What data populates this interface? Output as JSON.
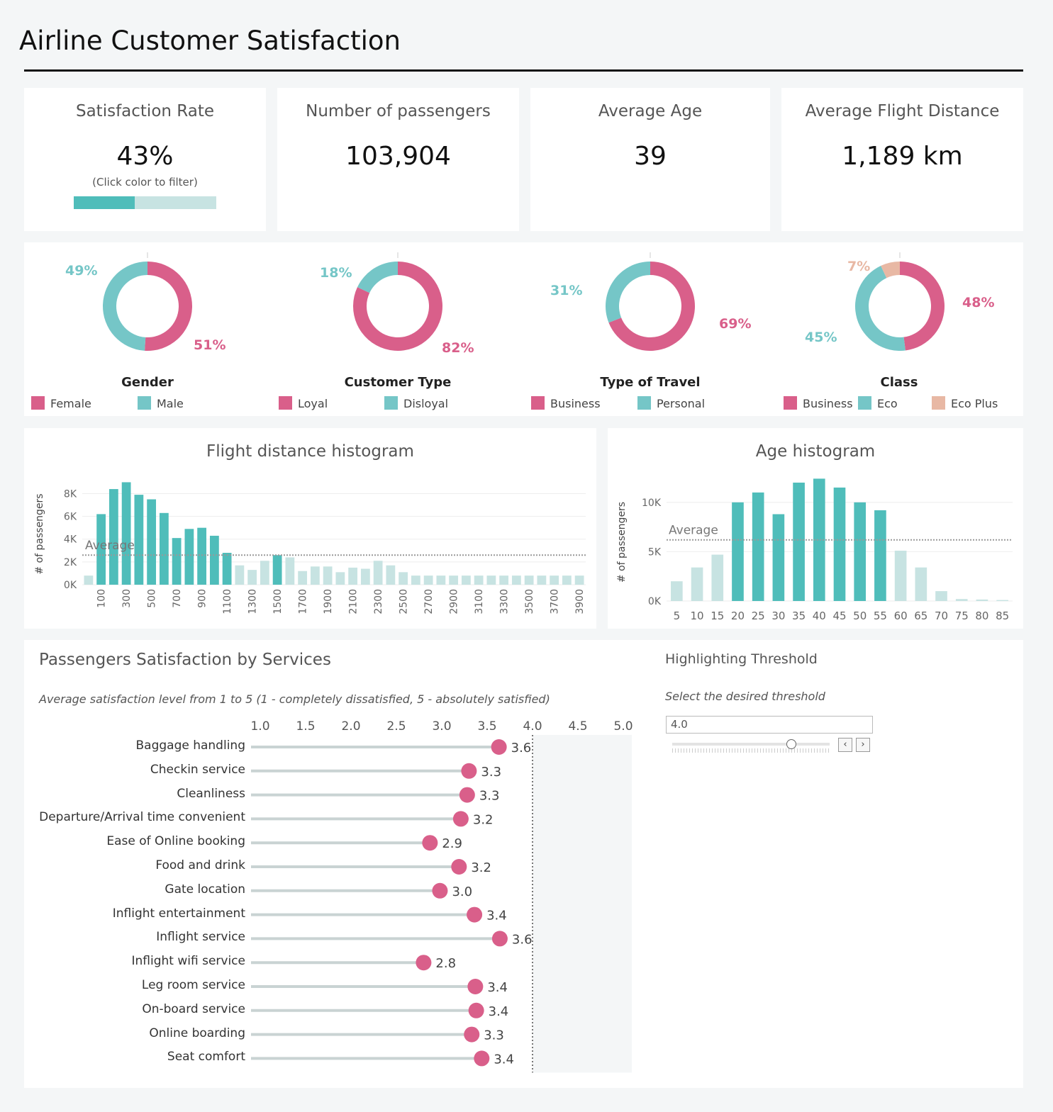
{
  "title": "Airline Customer Satisfaction",
  "colors": {
    "teal": "#4fbdba",
    "teal_light": "#c7e3e2",
    "pink": "#d95f8a",
    "peach": "#e8b8a4"
  },
  "kpis": [
    {
      "label": "Satisfaction Rate",
      "value": "43%",
      "hint": "(Click color to filter)",
      "fraction": 0.43
    },
    {
      "label": "Number of passengers",
      "value": "103,904"
    },
    {
      "label": "Average Age",
      "value": "39"
    },
    {
      "label": "Average Flight Distance",
      "value": "1,189 km"
    }
  ],
  "donuts": [
    {
      "title": "Gender",
      "slices": [
        {
          "name": "Female",
          "pct": 51,
          "label": "51%",
          "color": "#d95f8a"
        },
        {
          "name": "Male",
          "pct": 49,
          "label": "49%",
          "color": "#75c6c7"
        }
      ]
    },
    {
      "title": "Customer Type",
      "slices": [
        {
          "name": "Loyal",
          "pct": 82,
          "label": "82%",
          "color": "#d95f8a"
        },
        {
          "name": "Disloyal",
          "pct": 18,
          "label": "18%",
          "color": "#75c6c7"
        }
      ]
    },
    {
      "title": "Type of Travel",
      "slices": [
        {
          "name": "Business",
          "pct": 69,
          "label": "69%",
          "color": "#d95f8a"
        },
        {
          "name": "Personal",
          "pct": 31,
          "label": "31%",
          "color": "#75c6c7"
        }
      ]
    },
    {
      "title": "Class",
      "slices": [
        {
          "name": "Business",
          "pct": 48,
          "label": "48%",
          "color": "#d95f8a"
        },
        {
          "name": "Eco",
          "pct": 45,
          "label": "45%",
          "color": "#75c6c7"
        },
        {
          "name": "Eco Plus",
          "pct": 7,
          "label": "7%",
          "color": "#e8b8a4"
        }
      ]
    }
  ],
  "chart_data": [
    {
      "type": "bar",
      "title": "Flight distance histogram",
      "ylabel": "# of passengers",
      "average_label": "Average",
      "average": 2600,
      "yticks": [
        "0K",
        "2K",
        "4K",
        "6K",
        "8K"
      ],
      "ylim": [
        0,
        9400
      ],
      "highlight_upto": 1500,
      "x": [
        0,
        100,
        200,
        300,
        400,
        500,
        600,
        700,
        800,
        900,
        1000,
        1100,
        1200,
        1300,
        1400,
        1500,
        1600,
        1700,
        1800,
        1900,
        2000,
        2100,
        2200,
        2300,
        2400,
        2500,
        2600,
        2700,
        2800,
        2900,
        3000,
        3100,
        3200,
        3300,
        3400,
        3500,
        3600,
        3700,
        3800,
        3900
      ],
      "x_labels": [
        "100",
        "300",
        "500",
        "700",
        "900",
        "1100",
        "1300",
        "1500",
        "1700",
        "1900",
        "2100",
        "2300",
        "2500",
        "2700",
        "2900",
        "3100",
        "3300",
        "3500",
        "3700",
        "3900"
      ],
      "values": [
        800,
        6200,
        8400,
        9000,
        7900,
        7500,
        6300,
        4100,
        4900,
        5000,
        4300,
        2800,
        1700,
        1300,
        2100,
        2600,
        2400,
        1200,
        1600,
        1600,
        1100,
        1500,
        1400,
        2100,
        1700,
        1100,
        800,
        800,
        800,
        800,
        800,
        800,
        800,
        800,
        800,
        800,
        800,
        800,
        800,
        800
      ],
      "highlight": [
        false,
        true,
        true,
        true,
        true,
        true,
        true,
        true,
        true,
        true,
        true,
        true,
        false,
        false,
        false,
        true,
        false,
        false,
        false,
        false,
        false,
        false,
        false,
        false,
        false,
        false,
        false,
        false,
        false,
        false,
        false,
        false,
        false,
        false,
        false,
        false,
        false,
        false,
        false,
        false
      ]
    },
    {
      "type": "bar",
      "title": "Age histogram",
      "ylabel": "# of passengers",
      "average_label": "Average",
      "average": 6200,
      "yticks": [
        "0K",
        "5K",
        "10K"
      ],
      "ylim": [
        0,
        12500
      ],
      "categories": [
        "5",
        "10",
        "15",
        "20",
        "25",
        "30",
        "35",
        "40",
        "45",
        "50",
        "55",
        "60",
        "65",
        "70",
        "75",
        "80",
        "85"
      ],
      "values": [
        2000,
        3400,
        4700,
        10000,
        11000,
        8800,
        12000,
        12400,
        11500,
        10000,
        9200,
        5100,
        3400,
        1000,
        200,
        150,
        100
      ],
      "highlight": [
        false,
        false,
        false,
        true,
        true,
        true,
        true,
        true,
        true,
        true,
        true,
        false,
        false,
        false,
        false,
        false,
        false
      ]
    },
    {
      "type": "scatter",
      "title": "Passengers Satisfaction by Services",
      "subtitle": "Average satisfaction level from 1 to 5 (1 - completely dissatisfied, 5 - absolutely satisfied)",
      "xlim": [
        1,
        5
      ],
      "xticks": [
        "1.0",
        "1.5",
        "2.0",
        "2.5",
        "3.0",
        "3.5",
        "4.0",
        "4.5",
        "5.0"
      ],
      "threshold": 4.0,
      "categories": [
        "Baggage handling",
        "Checkin service",
        "Cleanliness",
        "Departure/Arrival time convenient",
        "Ease of Online booking",
        "Food and drink",
        "Gate location",
        "Inflight entertainment",
        "Inflight service",
        "Inflight wifi service",
        "Leg room service",
        "On-board service",
        "Online boarding",
        "Seat comfort"
      ],
      "values": [
        3.63,
        3.3,
        3.28,
        3.21,
        2.87,
        3.19,
        2.98,
        3.36,
        3.64,
        2.8,
        3.37,
        3.38,
        3.33,
        3.44
      ],
      "labels": [
        "3.6",
        "3.3",
        "3.3",
        "3.2",
        "2.9",
        "3.2",
        "3.0",
        "3.4",
        "3.6",
        "2.8",
        "3.4",
        "3.4",
        "3.3",
        "3.4"
      ]
    }
  ],
  "threshold_panel": {
    "title": "Highlighting Threshold",
    "subtitle": "Select the desired threshold",
    "value": "4.0",
    "prev": "‹",
    "next": "›"
  }
}
